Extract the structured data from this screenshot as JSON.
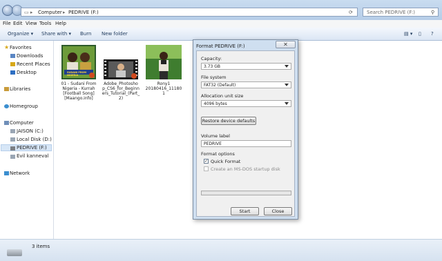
{
  "window": {
    "breadcrumb": [
      "Computer",
      "PEDRIVE (F:)"
    ],
    "search_placeholder": "Search PEDRIVE (F:)"
  },
  "menubar": [
    "File",
    "Edit",
    "View",
    "Tools",
    "Help"
  ],
  "toolbar": {
    "organize": "Organize ▾",
    "share": "Share with ▾",
    "burn": "Burn",
    "new_folder": "New folder"
  },
  "nav": {
    "favorites": "Favorites",
    "downloads": "Downloads",
    "recent": "Recent Places",
    "desktop": "Desktop",
    "libraries": "Libraries",
    "homegroup": "Homegroup",
    "computer": "Computer",
    "drive_c": "JAISON (C:)",
    "drive_d": "Local Disk (D:)",
    "drive_f": "PEDRIVE (F:)",
    "evil": "Evil kanneval",
    "network": "Network"
  },
  "files": [
    {
      "line1": "01 - Sudani From",
      "line2": "Nigeria - Kurrah",
      "line3": "[Football Song]",
      "line4": "[Maango.info]",
      "thumb_label": "SUDANI FROM NIGERIA"
    },
    {
      "line1": "Adobe_Photosho",
      "line2": "p_CS6_for_Beginn",
      "line3": "ers_Tutorial_(Part_",
      "line4": "2)"
    },
    {
      "line1": "Rony1",
      "line2": "20180416_11180",
      "line3": "1",
      "line4": ""
    }
  ],
  "status": {
    "count": "3 items"
  },
  "dialog": {
    "title": "Format PEDRIVE (F:)",
    "close": "✕",
    "capacity_label": "Capacity:",
    "capacity_value": "3.73 GB",
    "fs_label": "File system",
    "fs_value": "FAT32 (Default)",
    "alloc_label": "Allocation unit size",
    "alloc_value": "4096 bytes",
    "restore": "Restore device defaults",
    "volume_label": "Volume label",
    "volume_value": "PEDRIVE",
    "options_label": "Format options",
    "quick_format": "Quick Format",
    "msdos": "Create an MS-DOS startup disk",
    "progress": 0.0,
    "start": "Start",
    "close_btn": "Close"
  },
  "colors": {
    "accent": "#2fae3b",
    "selected": "#d7e6f7",
    "chrome": "#b6cde8"
  }
}
